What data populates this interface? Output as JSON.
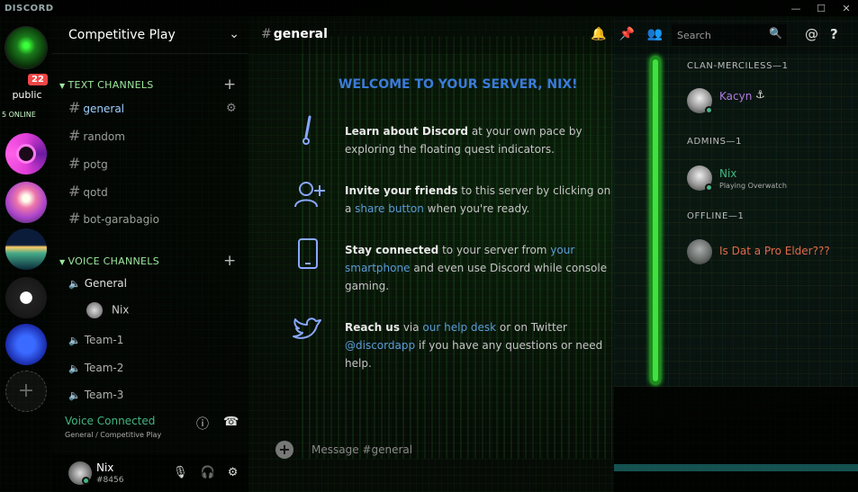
{
  "app": {
    "title": "DISCORD"
  },
  "window_controls": {
    "minimize": "—",
    "maximize": "☐",
    "close": "✕"
  },
  "servers": {
    "public_badge": "22",
    "public_label": "public",
    "online_label": "5 ONLINE"
  },
  "sidebar": {
    "server_name": "Competitive Play",
    "text_category": "TEXT CHANNELS",
    "text_channels": [
      "general",
      "random",
      "potg",
      "qotd",
      "bot-garabagio"
    ],
    "voice_category": "VOICE CHANNELS",
    "voice_channels": [
      "General",
      "Team-1",
      "Team-2",
      "Team-3"
    ],
    "voice_user": "Nix"
  },
  "voice_connected": {
    "title": "Voice Connected",
    "subtitle": "General / Competitive Play"
  },
  "user_panel": {
    "name": "Nix",
    "tag": "#8456"
  },
  "chat": {
    "channel": "general",
    "search_placeholder": "Search",
    "welcome": "WELCOME TO YOUR SERVER, NIX!",
    "tips": [
      {
        "bold": "Learn about Discord",
        "rest": " at your own pace by exploring the floating quest indicators."
      },
      {
        "bold": "Invite your friends",
        "rest": " to this server by clicking on a ",
        "link": "share button",
        "rest2": " when you're ready."
      },
      {
        "bold": "Stay connected",
        "rest": " to your server from ",
        "link": "your smartphone",
        "rest2": " and even use Discord while console gaming."
      },
      {
        "bold": "Reach us",
        "rest": " via ",
        "link": "our help desk",
        "rest2": " or on Twitter ",
        "link2": "@discordapp",
        "rest3": " if you have any questions or need help."
      }
    ],
    "input_placeholder": "Message #general"
  },
  "members": {
    "groups": [
      {
        "name": "CLAN-MERCILESS—1",
        "members": [
          {
            "name": "Kacyn",
            "activity": "",
            "color": "#b07be0"
          }
        ]
      },
      {
        "name": "ADMINS—1",
        "members": [
          {
            "name": "Nix",
            "activity": "Playing Overwatch",
            "color": "#43b581"
          }
        ]
      },
      {
        "name": "OFFLINE—1",
        "members": [
          {
            "name": "Is Dat a Pro Elder???",
            "activity": "",
            "color": "#e06a4a"
          }
        ]
      }
    ]
  },
  "colors": {
    "accent": "#3b7bd9",
    "online": "#43b581",
    "category": "#9ee89e",
    "badge": "#f04747"
  }
}
